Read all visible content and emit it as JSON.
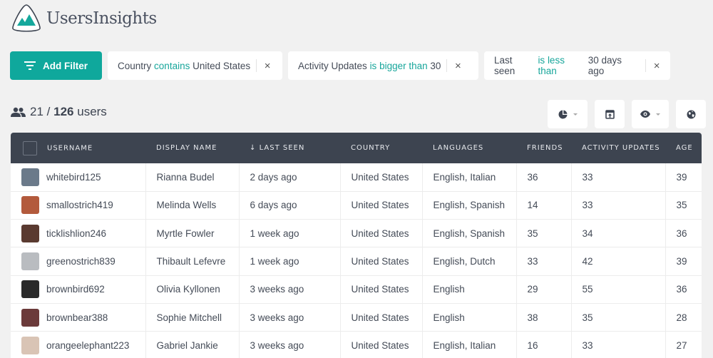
{
  "app": {
    "name": "UsersInsights",
    "logo_icon": "mountains-logo-icon"
  },
  "colors": {
    "accent": "#0fa89c",
    "header_bg": "#3d4450",
    "page_bg": "#f1f1f1",
    "operator_text": "#17a69b"
  },
  "filters": {
    "add_label": "Add Filter",
    "add_icon": "filter-lines-icon",
    "items": [
      {
        "field": "Country",
        "operator": "contains",
        "value": "United States"
      },
      {
        "field": "Activity Updates",
        "operator": "is bigger than",
        "value": "30"
      },
      {
        "field": "Last seen",
        "operator": "is less than",
        "value": "30 days ago"
      }
    ],
    "remove_glyph": "×"
  },
  "summary": {
    "icon": "users-icon",
    "shown": "21",
    "separator": "/",
    "total": "126",
    "unit": "users"
  },
  "toolbar": [
    {
      "name": "segments-button",
      "icon": "pie-chart-icon",
      "has_dropdown": true
    },
    {
      "name": "export-button",
      "icon": "export-icon",
      "has_dropdown": false
    },
    {
      "name": "columns-visibility-button",
      "icon": "eye-icon",
      "has_dropdown": true
    },
    {
      "name": "map-view-button",
      "icon": "globe-icon",
      "has_dropdown": false
    }
  ],
  "table": {
    "sort_indicator": "↓",
    "columns": [
      "Username",
      "Display Name",
      "Last Seen",
      "Country",
      "Languages",
      "Friends",
      "Activity Updates",
      "Age"
    ],
    "sorted_column": "Last Seen",
    "rows": [
      {
        "username": "whitebird125",
        "display_name": "Rianna Budel",
        "last_seen": "2 days ago",
        "country": "United States",
        "languages": "English, Italian",
        "friends": "36",
        "activity_updates": "33",
        "age": "39",
        "avatar_color": "#6b7a8a"
      },
      {
        "username": "smallostrich419",
        "display_name": "Melinda Wells",
        "last_seen": "6 days ago",
        "country": "United States",
        "languages": "English, Spanish",
        "friends": "14",
        "activity_updates": "33",
        "age": "35",
        "avatar_color": "#b35a3c"
      },
      {
        "username": "ticklishlion246",
        "display_name": "Myrtle Fowler",
        "last_seen": "1 week ago",
        "country": "United States",
        "languages": "English, Spanish",
        "friends": "35",
        "activity_updates": "34",
        "age": "36",
        "avatar_color": "#5a3a30"
      },
      {
        "username": "greenostrich839",
        "display_name": "Thibault Lefevre",
        "last_seen": "1 week ago",
        "country": "United States",
        "languages": "English, Dutch",
        "friends": "33",
        "activity_updates": "42",
        "age": "39",
        "avatar_color": "#b9bcc0"
      },
      {
        "username": "brownbird692",
        "display_name": "Olivia Kyllonen",
        "last_seen": "3 weeks ago",
        "country": "United States",
        "languages": "English",
        "friends": "29",
        "activity_updates": "55",
        "age": "36",
        "avatar_color": "#2a2a2a"
      },
      {
        "username": "brownbear388",
        "display_name": "Sophie Mitchell",
        "last_seen": "3 weeks ago",
        "country": "United States",
        "languages": "English",
        "friends": "38",
        "activity_updates": "35",
        "age": "28",
        "avatar_color": "#6b3a3a"
      },
      {
        "username": "orangeelephant223",
        "display_name": "Gabriel Jankie",
        "last_seen": "3 weeks ago",
        "country": "United States",
        "languages": "English, Italian",
        "friends": "16",
        "activity_updates": "33",
        "age": "27",
        "avatar_color": "#d9c4b5"
      }
    ]
  }
}
